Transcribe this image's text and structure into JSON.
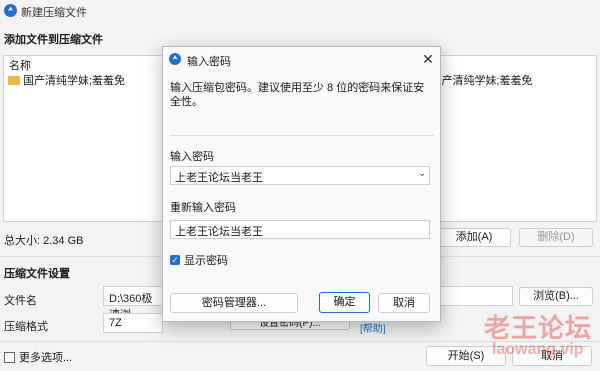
{
  "window": {
    "title": "新建压缩文件"
  },
  "add_section": {
    "title": "添加文件到压缩文件",
    "column_header": "名称",
    "file_item": "国产清纯学妹;羞羞免",
    "file_item_right": "l产清纯学妹;羞羞免"
  },
  "summary": {
    "total_size": "总大小: 2.34 GB",
    "add_button": "添加(A)",
    "delete_button": "删除(D)"
  },
  "settings": {
    "title": "压缩文件设置",
    "filename_label": "文件名",
    "filename_value": "D:\\360极速浏",
    "browse_button": "浏览(B)...",
    "format_label": "压缩格式",
    "format_value": "7Z",
    "set_password_button": "设置密码(P)...",
    "help_link": "[帮助]"
  },
  "footer": {
    "more_options": "更多选项...",
    "start_button": "开始(S)",
    "cancel_button": "取消"
  },
  "dialog": {
    "title": "输入密码",
    "description": "输入压缩包密码。建议使用至少 8 位的密码来保证安全性。",
    "password_label": "输入密码",
    "password_value": "上老王论坛当老王",
    "confirm_label": "重新输入密码",
    "confirm_value": "上老王论坛当老王",
    "show_password_label": "显示密码",
    "show_password_checked": true,
    "manager_button": "密码管理器...",
    "ok_button": "确定",
    "cancel_button": "取消"
  },
  "watermark": {
    "line1": "老王论坛",
    "line2": "laowang.vip"
  },
  "colors": {
    "accent": "#1f6fd1",
    "watermark": "#dc2828"
  }
}
